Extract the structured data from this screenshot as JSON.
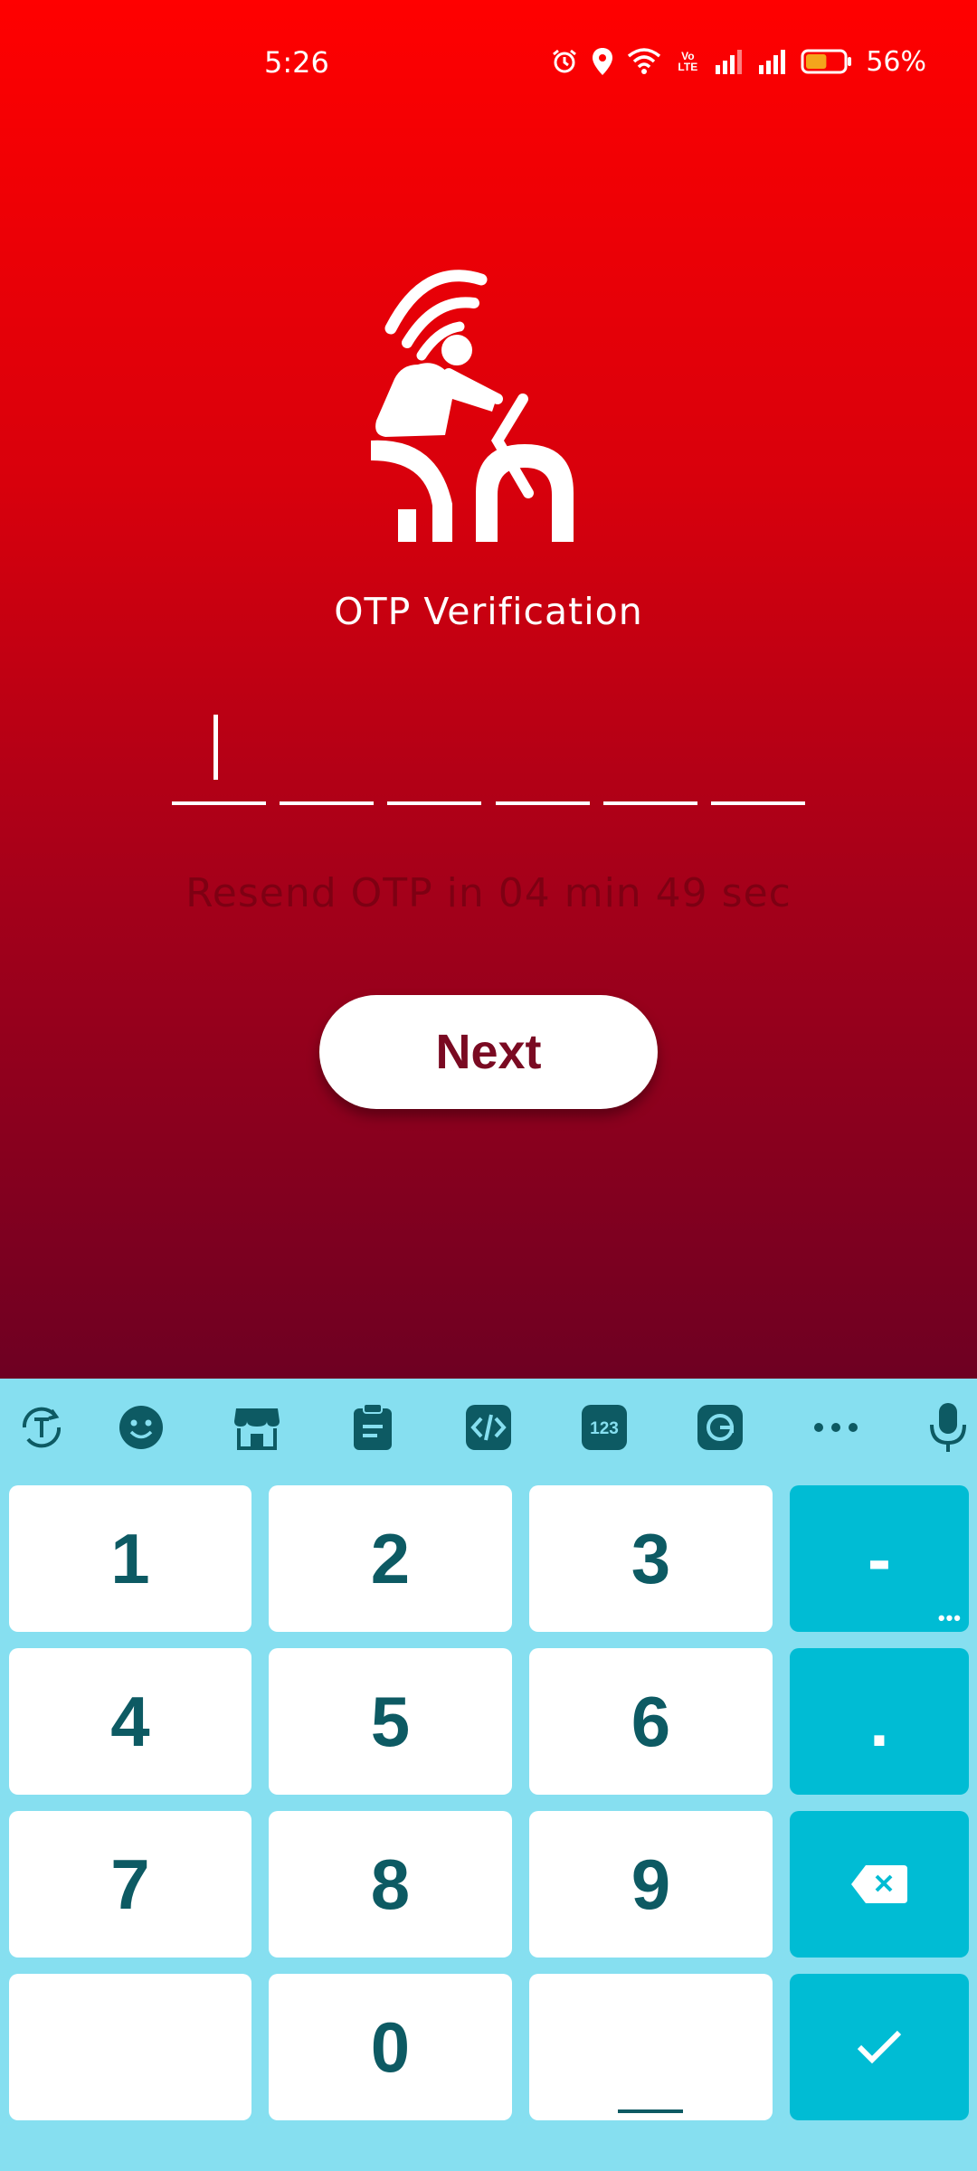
{
  "status_bar": {
    "time": "5:26",
    "volte_label": "Vo LTE",
    "battery_percent": "56%",
    "battery_level": 0.56,
    "icons": [
      "alarm-icon",
      "location-icon",
      "wifi-icon",
      "volte-icon",
      "signal-icon",
      "signal-icon",
      "battery-icon"
    ]
  },
  "header": {
    "logo_icon": "cyclist-signal-logo-icon",
    "title": "OTP Verification"
  },
  "otp": {
    "length": 6,
    "value": "",
    "resend_text": "Resend OTP in 04 min 49 sec"
  },
  "actions": {
    "next_label": "Next"
  },
  "keyboard": {
    "toolbar_icons": [
      "text-switch-icon",
      "emoji-icon",
      "store-icon",
      "clipboard-icon",
      "code-icon",
      "numbers-icon",
      "gif-icon",
      "more-icon",
      "microphone-icon"
    ],
    "numbers_badge": "123",
    "keys": {
      "k1": "1",
      "k2": "2",
      "k3": "3",
      "minus": "-",
      "k4": "4",
      "k5": "5",
      "k6": "6",
      "period": ".",
      "k7": "7",
      "k8": "8",
      "k9": "9",
      "k0": "0"
    },
    "more_dots": "•••",
    "colors": {
      "background": "#86dff0",
      "key": "#ffffff",
      "function_key": "#00bcd4",
      "text": "#0d5a63"
    }
  },
  "colors": {
    "gradient_top": "#ff0000",
    "gradient_bottom": "#6e0022",
    "next_text": "#7a0a22"
  }
}
